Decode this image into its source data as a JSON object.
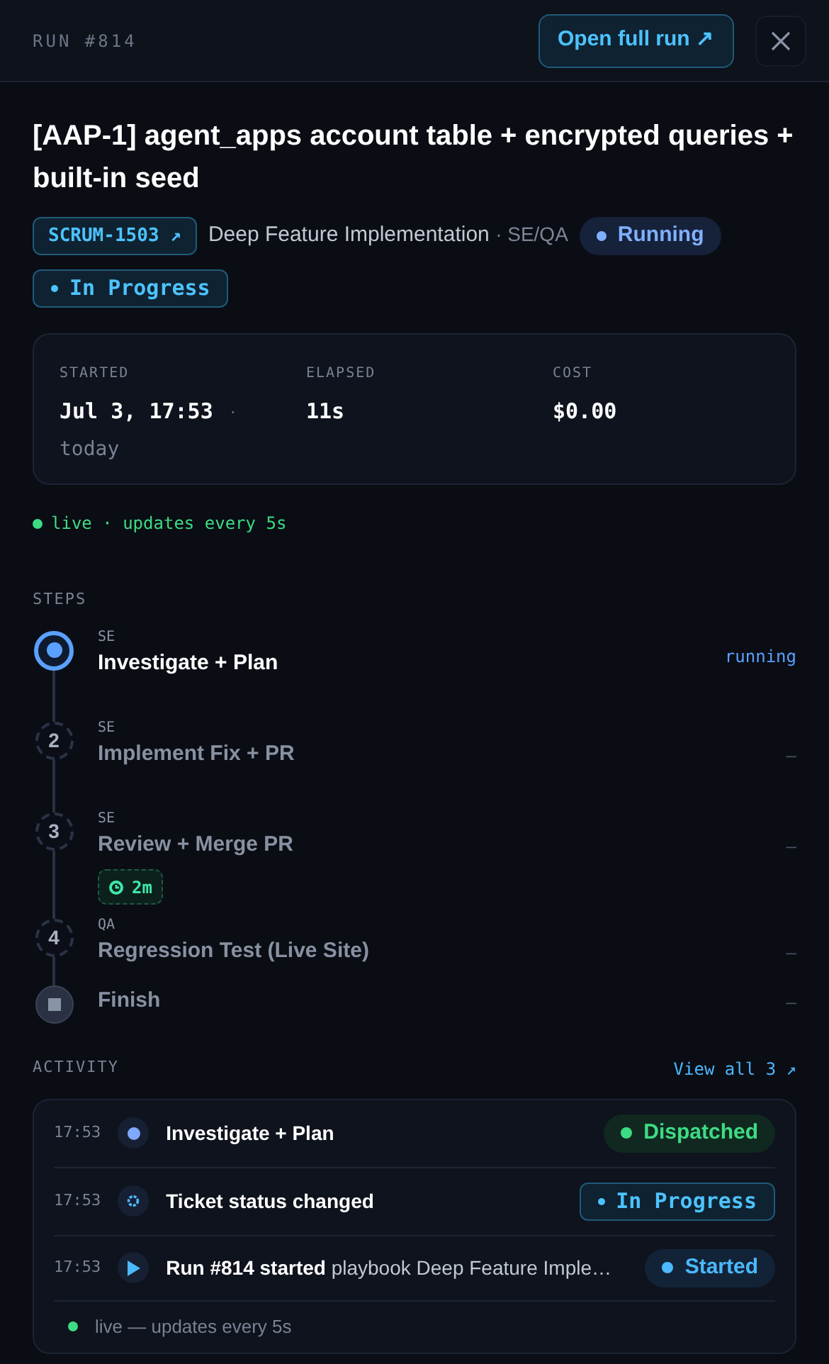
{
  "header": {
    "run_label": "RUN #814",
    "open_button": "Open full run",
    "open_icon": "↗"
  },
  "title": "[AAP-1] agent_apps account table + encrypted queries + built-in seed",
  "ticket": {
    "key": "SCRUM-1503",
    "icon": "↗"
  },
  "playbook": {
    "name": "Deep Feature Implementation",
    "roles": "· SE/QA"
  },
  "run_status": {
    "label": "Running",
    "kind": "pill"
  },
  "ticket_status": {
    "label": "In Progress",
    "kind": "outline"
  },
  "stats": [
    {
      "label": "STARTED",
      "value": "Jul 3, 17:53",
      "suffix": "·",
      "note": "today"
    },
    {
      "label": "ELAPSED",
      "value": "11s"
    },
    {
      "label": "COST",
      "value": "$0.00"
    }
  ],
  "live": "live · updates every 5s",
  "steps_heading": "STEPS",
  "steps": [
    {
      "kind": "running",
      "role": "SE",
      "name": "Investigate + Plan",
      "status": "running"
    },
    {
      "kind": "pending",
      "number": "2",
      "role": "SE",
      "name": "Implement Fix + PR",
      "status": "—"
    },
    {
      "kind": "pending",
      "number": "3",
      "role": "SE",
      "name": "Review + Merge PR",
      "timer": "2m",
      "status": "—"
    },
    {
      "kind": "pending",
      "number": "4",
      "role": "QA",
      "name": "Regression Test (Live Site)",
      "status": "—"
    },
    {
      "kind": "finish",
      "name": "Finish",
      "status": "—"
    }
  ],
  "activity_heading": "ACTIVITY",
  "view_all": "View all 3 ↗",
  "activity": [
    {
      "time": "17:53",
      "kind": "dot",
      "title": "Investigate + Plan",
      "badge": {
        "label": "Dispatched",
        "kind": "green"
      }
    },
    {
      "time": "17:53",
      "kind": "gear",
      "title": "Ticket status changed",
      "badge": {
        "label": "In Progress",
        "kind": "outline"
      }
    },
    {
      "time": "17:53",
      "kind": "play",
      "title": "Run #814 started",
      "detail": "playbook Deep Feature Imple…",
      "badge": {
        "label": "Started",
        "kind": "blue"
      }
    }
  ],
  "activity_footer": "live — updates every 5s"
}
